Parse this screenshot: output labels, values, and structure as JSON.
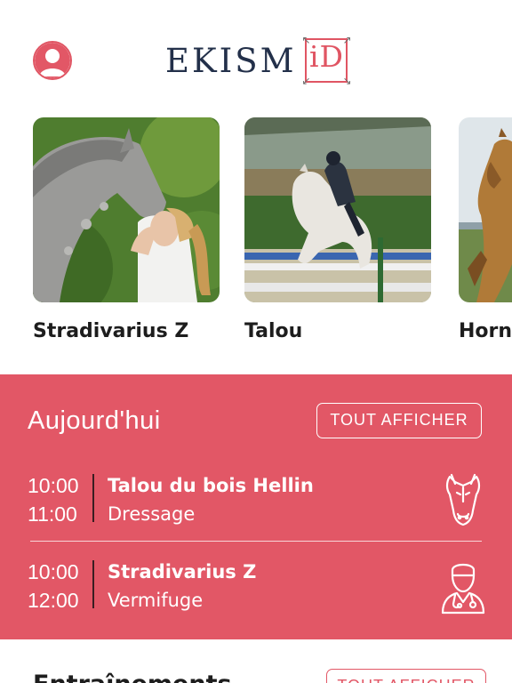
{
  "header": {
    "logo_text": "EKISM",
    "logo_mark": "iD",
    "accent_color": "#e25766",
    "avatar_icon": "user-avatar-icon"
  },
  "horses": [
    {
      "name": "Stradivarius Z"
    },
    {
      "name": "Talou"
    },
    {
      "name": "Horn"
    }
  ],
  "today": {
    "title": "Aujourd'hui",
    "see_all_label": "TOUT AFFICHER",
    "events": [
      {
        "start": "10:00",
        "end": "11:00",
        "horse": "Talou du bois Hellin",
        "activity": "Dressage",
        "icon": "horse-head-icon"
      },
      {
        "start": "10:00",
        "end": "12:00",
        "horse": "Stradivarius Z",
        "activity": "Vermifuge",
        "icon": "veterinarian-icon"
      }
    ]
  },
  "trainings": {
    "title": "Entraînements",
    "see_all_label": "TOUT AFFICHER"
  }
}
